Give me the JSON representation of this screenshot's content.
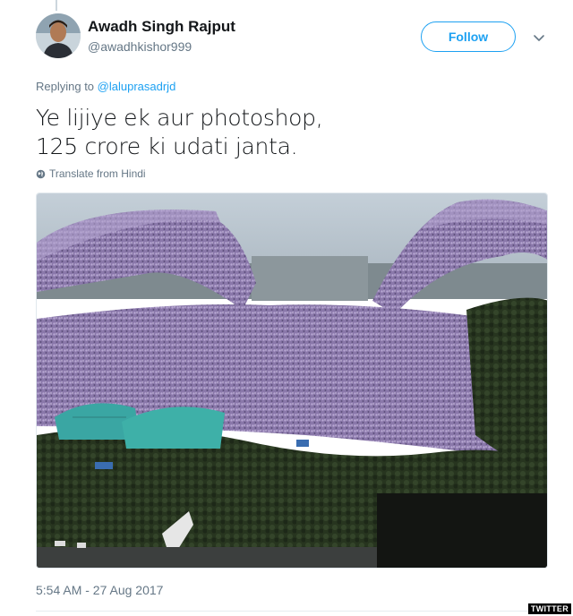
{
  "author": {
    "display_name": "Awadh Singh Rajput",
    "handle": "@awadhkishor999",
    "avatar_icon": "user-avatar"
  },
  "follow_button": {
    "label": "Follow"
  },
  "menu": {
    "icon": "chevron-down-icon"
  },
  "reply": {
    "prefix": "Replying to",
    "mention": "@laluprasadrjd"
  },
  "tweet": {
    "line1": "Ye lijiye ek aur photoshop,",
    "line2": "125 crore ki udati janta."
  },
  "translate": {
    "label": "Translate from Hindi",
    "icon": "globe-icon"
  },
  "timestamp": "5:54 AM - 27 Aug 2017",
  "watermark": "TWITTER",
  "colors": {
    "accent": "#1da1f2",
    "secondary_text": "#657786",
    "primary_text": "#14171a"
  }
}
